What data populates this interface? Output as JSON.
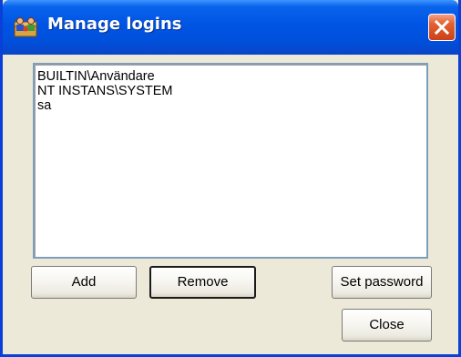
{
  "window": {
    "title": "Manage logins",
    "title_icon": "users-icon",
    "close_icon": "close-icon"
  },
  "logins": {
    "items": [
      "BUILTIN\\Användare",
      "NT INSTANS\\SYSTEM",
      "sa"
    ]
  },
  "buttons": {
    "add": "Add",
    "remove": "Remove",
    "set_password": "Set password",
    "close": "Close"
  },
  "colors": {
    "titlebar": "#0054e3",
    "dialog_background": "#ece9d8",
    "close_button": "#e4622f",
    "list_border": "#7f9db9"
  }
}
